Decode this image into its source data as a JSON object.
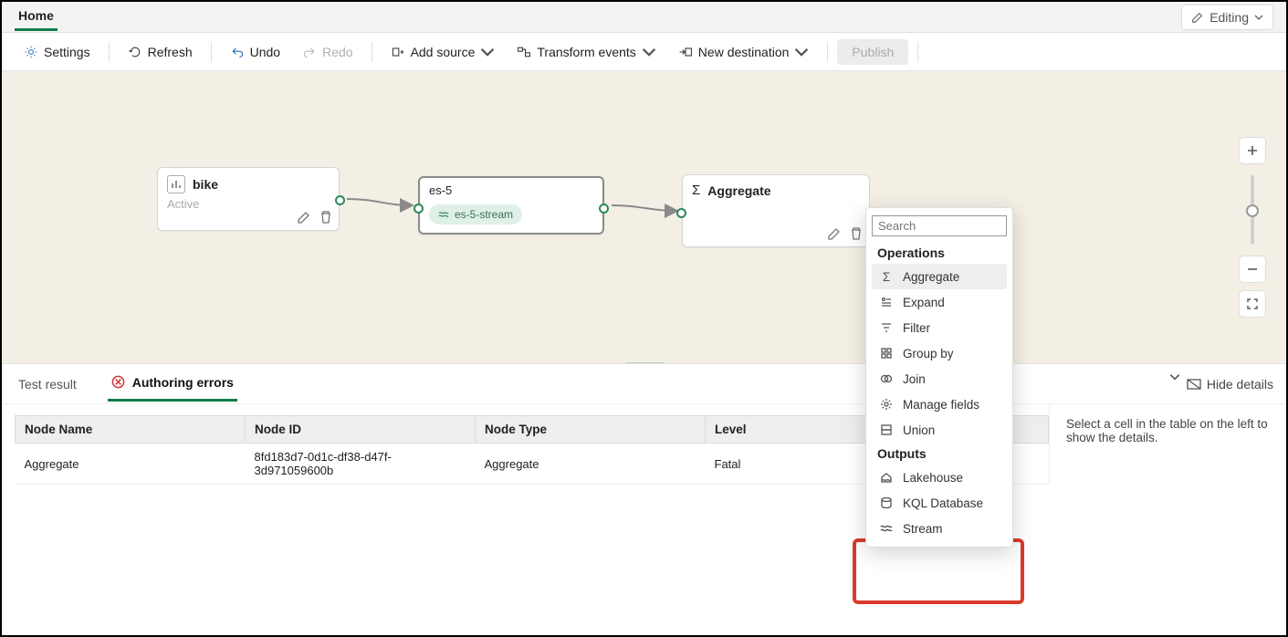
{
  "topTab": "Home",
  "modeLabel": "Editing",
  "toolbar": {
    "settings": "Settings",
    "refresh": "Refresh",
    "undo": "Undo",
    "redo": "Redo",
    "addSource": "Add source",
    "transform": "Transform events",
    "newDest": "New destination",
    "publish": "Publish"
  },
  "nodes": {
    "bike": {
      "title": "bike",
      "subtitle": "Active"
    },
    "es5": {
      "title": "es-5",
      "chip": "es-5-stream"
    },
    "agg": {
      "title": "Aggregate"
    }
  },
  "popup": {
    "searchPlaceholder": "Search",
    "operationsHeader": "Operations",
    "operations": [
      "Aggregate",
      "Expand",
      "Filter",
      "Group by",
      "Join",
      "Manage fields",
      "Union"
    ],
    "outputsHeader": "Outputs",
    "outputs": [
      "Lakehouse",
      "KQL Database",
      "Stream"
    ]
  },
  "bottom": {
    "tab1": "Test result",
    "tab2": "Authoring errors",
    "hide": "Hide details",
    "cols": {
      "name": "Node Name",
      "id": "Node ID",
      "type": "Node Type",
      "level": "Level"
    },
    "row": {
      "name": "Aggregate",
      "id": "8fd183d7-0d1c-df38-d47f-3d971059600b",
      "type": "Aggregate",
      "level": "Fatal"
    },
    "sideMsg": "Select a cell in the table on the left to show the details."
  }
}
